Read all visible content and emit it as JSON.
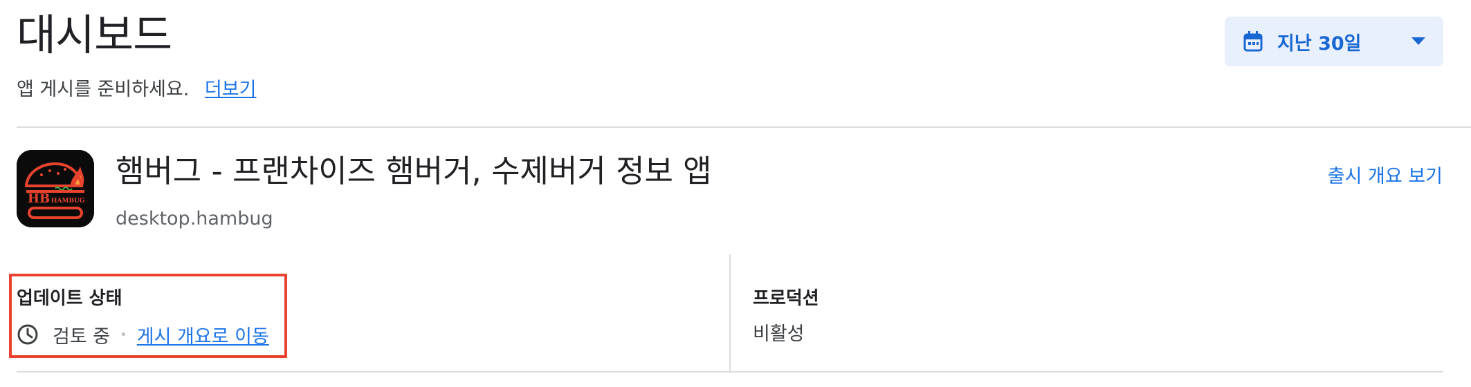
{
  "header": {
    "title": "대시보드",
    "subtitle": "앱 게시를 준비하세요.",
    "more_link": "더보기"
  },
  "date_range": {
    "label": "지난 30일",
    "icon": "calendar-icon",
    "dropdown_icon": "caret-down-icon"
  },
  "app": {
    "name": "햄버그 - 프랜차이즈 햄버거, 수제버거 정보 앱",
    "package": "desktop.hambug",
    "release_overview_link": "출시 개요 보기",
    "icon_text": {
      "initials": "HB",
      "brand": "HAMBUG"
    }
  },
  "update_status": {
    "title": "업데이트 상태",
    "icon": "clock-icon",
    "value": "검토 중",
    "separator": "•",
    "link": "게시 개요로 이동"
  },
  "production": {
    "title": "프로덕션",
    "value": "비활성"
  },
  "colors": {
    "link": "#1a73e8",
    "dropdown_bg": "#e8f0fe",
    "highlight_border": "#e8432f",
    "divider": "#dadce0"
  }
}
